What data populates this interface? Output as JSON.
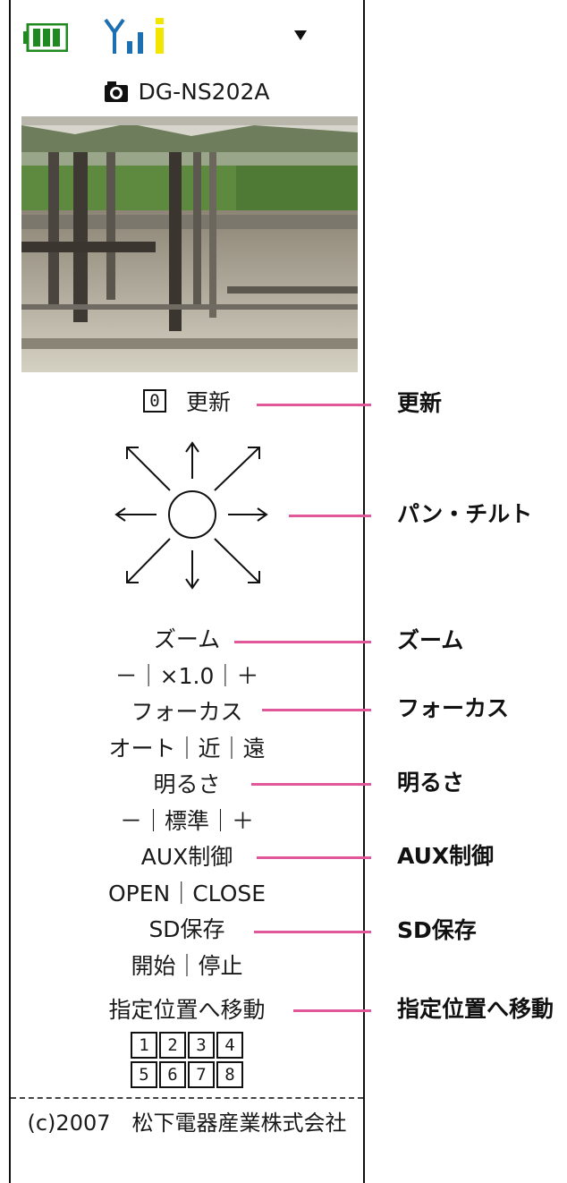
{
  "status_bar": {
    "battery_icon": "battery-full-icon",
    "signal_icon": "antenna-signal-icon",
    "battery_color": "#1f8a1f",
    "level_color": "#f2e600",
    "menu_icon": "dropdown-triangle-icon"
  },
  "camera": {
    "icon": "camera-icon",
    "name": "DG-NS202A"
  },
  "refresh": {
    "key": "0",
    "label": "更新"
  },
  "pan_tilt_icon": "pan-tilt-arrows-icon",
  "controls": {
    "zoom": {
      "title": "ズーム",
      "options": "－｜×1.0｜＋"
    },
    "focus": {
      "title": "フォーカス",
      "options": "オート｜近｜遠"
    },
    "brightness": {
      "title": "明るさ",
      "options": "－｜標準｜＋"
    },
    "aux": {
      "title": "AUX制御",
      "options": "OPEN｜CLOSE"
    },
    "sd": {
      "title": "SD保存",
      "options": "開始｜停止"
    },
    "preset": {
      "title": "指定位置へ移動",
      "keys_row1": [
        "1",
        "2",
        "3",
        "4"
      ],
      "keys_row2": [
        "5",
        "6",
        "7",
        "8"
      ]
    }
  },
  "footer": "(c)2007　松下電器産業株式会社",
  "callouts": {
    "refresh": "更新",
    "pan_tilt": "パン・チルト",
    "zoom": "ズーム",
    "focus": "フォーカス",
    "brightness": "明るさ",
    "aux": "AUX制御",
    "sd": "SD保存",
    "preset": "指定位置へ移動"
  },
  "callout_color": "#e0579a"
}
